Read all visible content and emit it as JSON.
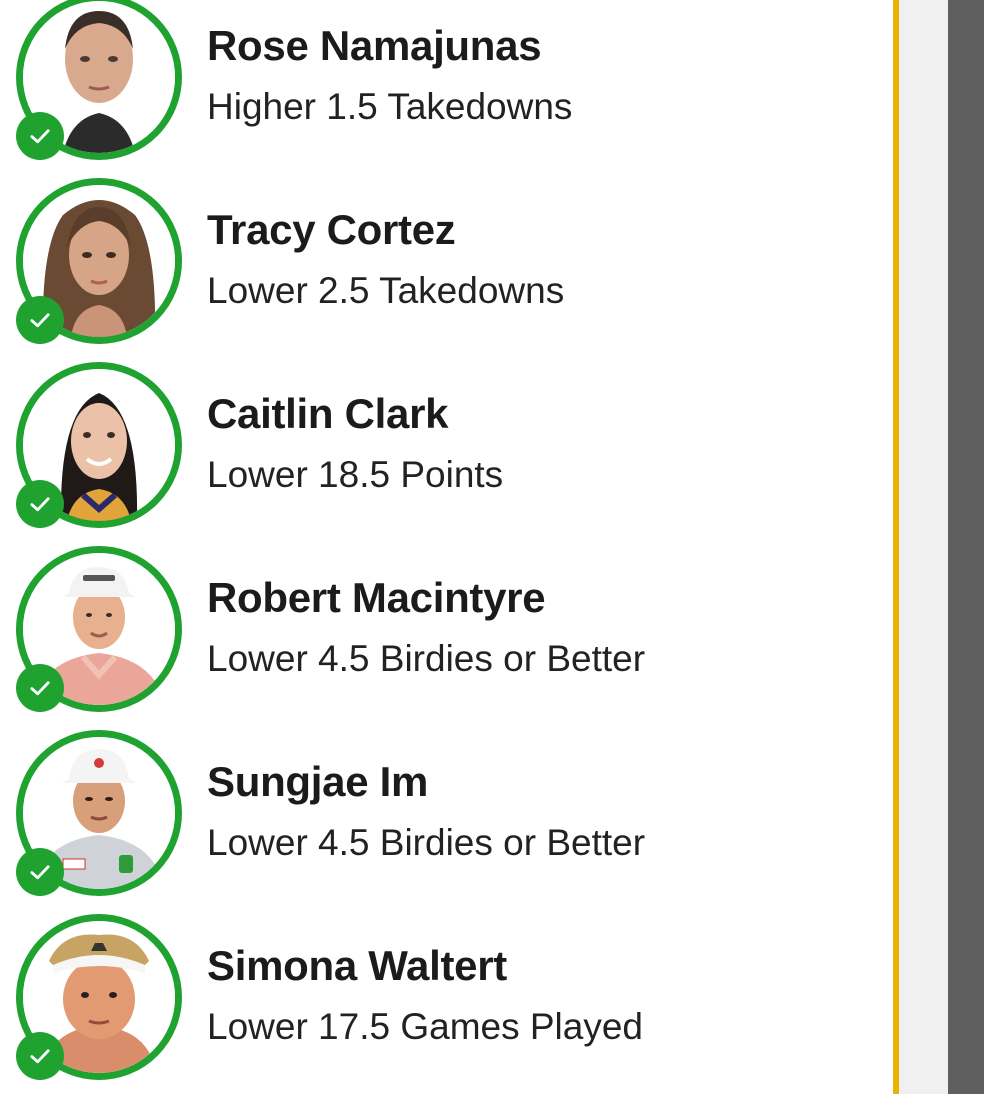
{
  "colors": {
    "ring_green": "#1FA22F",
    "divider_yellow": "#E8B400",
    "panel_gray": "#F0F0F0",
    "scrollbar_gray": "#5F5F5F",
    "text_dark": "#1B1B1B"
  },
  "picks": [
    {
      "name": "Rose Namajunas",
      "pick": "Higher 1.5 Takedowns",
      "status_icon": "check-icon"
    },
    {
      "name": "Tracy Cortez",
      "pick": "Lower 2.5 Takedowns",
      "status_icon": "check-icon"
    },
    {
      "name": "Caitlin Clark",
      "pick": "Lower 18.5 Points",
      "status_icon": "check-icon"
    },
    {
      "name": "Robert Macintyre",
      "pick": "Lower 4.5 Birdies or Better",
      "status_icon": "check-icon"
    },
    {
      "name": "Sungjae Im",
      "pick": "Lower 4.5 Birdies or Better",
      "status_icon": "check-icon"
    },
    {
      "name": "Simona Waltert",
      "pick": "Lower 17.5 Games Played",
      "status_icon": "check-icon"
    }
  ]
}
